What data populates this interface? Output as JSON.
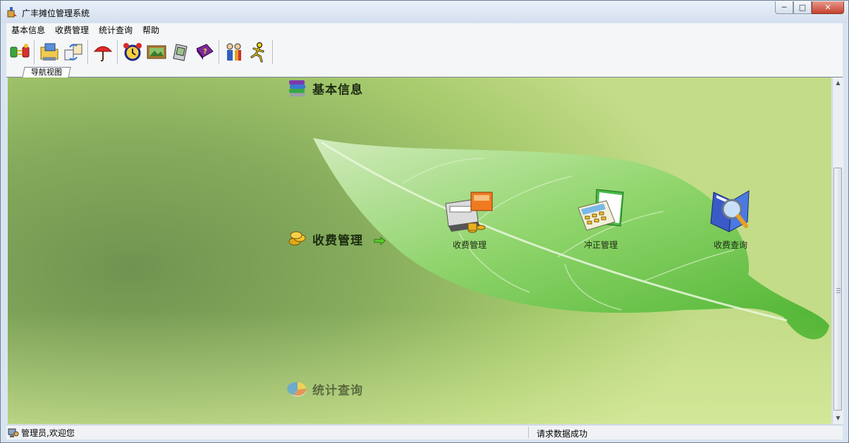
{
  "window": {
    "title": "广丰摊位管理系统",
    "controls": {
      "minimize": "─",
      "maximize": "□",
      "close": "✕"
    }
  },
  "menu": [
    {
      "label": "基本信息"
    },
    {
      "label": "收费管理"
    },
    {
      "label": "统计查询"
    },
    {
      "label": "帮助"
    }
  ],
  "toolbar": {
    "buttons": [
      {
        "icon": "connect-icon"
      },
      {
        "icon": "folder-computer-icon"
      },
      {
        "icon": "transfer-icon"
      },
      {
        "icon": "umbrella-icon"
      },
      {
        "icon": "alarm-clock-icon"
      },
      {
        "icon": "picture-icon"
      },
      {
        "icon": "handheld-device-icon"
      },
      {
        "icon": "help-book-icon"
      },
      {
        "icon": "users-icon"
      },
      {
        "icon": "exit-runner-icon"
      }
    ]
  },
  "tabs": [
    {
      "label": "导航视图"
    }
  ],
  "navigation": {
    "sections": {
      "basic_info": "基本信息",
      "fee_management": "收费管理",
      "stats_query": "统计查询"
    },
    "features": {
      "fee_collect": "收费管理",
      "offset_manage": "冲正管理",
      "fee_query": "收费查询"
    }
  },
  "scrollbar": {
    "up": "▲",
    "down": "▼"
  },
  "status": {
    "user_text": "管理员,欢迎您",
    "message": "请求数据成功"
  },
  "colors": {
    "title_bg": "#d3dfee",
    "content_green": "#85ab5c",
    "leaf_green": "#5cc23e",
    "close_red": "#c4412d"
  }
}
